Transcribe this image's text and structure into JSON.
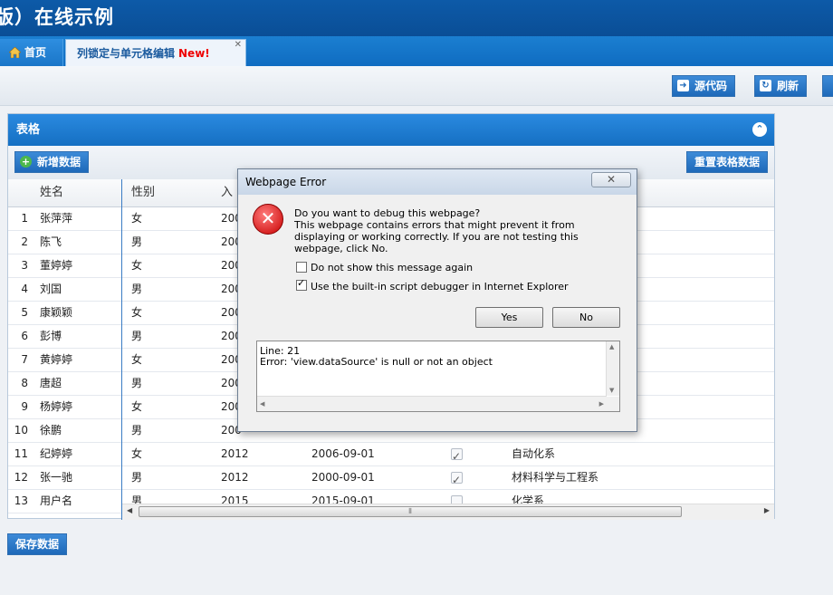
{
  "header": {
    "title": "版）在线示例"
  },
  "tabs": [
    {
      "label": "首页"
    },
    {
      "label": "列锁定与单元格编辑",
      "badge": "New!"
    }
  ],
  "toolbar": {
    "source_label": "源代码",
    "refresh_label": "刷新"
  },
  "panel": {
    "title": "表格",
    "add_label": "新增数据",
    "reset_label": "重置表格数据"
  },
  "grid": {
    "columns": [
      "姓名",
      "性别",
      "入"
    ],
    "rows": [
      {
        "n": "1",
        "name": "张萍萍",
        "sex": "女",
        "year": "200",
        "date": "",
        "checked": null,
        "dept": ""
      },
      {
        "n": "2",
        "name": "陈飞",
        "sex": "男",
        "year": "200",
        "date": "",
        "checked": null,
        "dept": ""
      },
      {
        "n": "3",
        "name": "董婷婷",
        "sex": "女",
        "year": "200",
        "date": "",
        "checked": null,
        "dept": ""
      },
      {
        "n": "4",
        "name": "刘国",
        "sex": "男",
        "year": "200",
        "date": "",
        "checked": null,
        "dept": ""
      },
      {
        "n": "5",
        "name": "康颖颖",
        "sex": "女",
        "year": "200",
        "date": "",
        "checked": null,
        "dept": ""
      },
      {
        "n": "6",
        "name": "彭博",
        "sex": "男",
        "year": "200",
        "date": "",
        "checked": null,
        "dept": ""
      },
      {
        "n": "7",
        "name": "黄婷婷",
        "sex": "女",
        "year": "200",
        "date": "",
        "checked": null,
        "dept": ""
      },
      {
        "n": "8",
        "name": "唐超",
        "sex": "男",
        "year": "200",
        "date": "",
        "checked": null,
        "dept": ""
      },
      {
        "n": "9",
        "name": "杨婷婷",
        "sex": "女",
        "year": "200",
        "date": "",
        "checked": null,
        "dept": ""
      },
      {
        "n": "10",
        "name": "徐鹏",
        "sex": "男",
        "year": "200",
        "date": "",
        "checked": null,
        "dept": ""
      },
      {
        "n": "11",
        "name": "纪婷婷",
        "sex": "女",
        "year": "2012",
        "date": "2006-09-01",
        "checked": true,
        "dept": "自动化系"
      },
      {
        "n": "12",
        "name": "张一驰",
        "sex": "男",
        "year": "2012",
        "date": "2000-09-01",
        "checked": true,
        "dept": "材料科学与工程系"
      },
      {
        "n": "13",
        "name": "用户名",
        "sex": "男",
        "year": "2015",
        "date": "2015-09-01",
        "checked": false,
        "dept": "化学系"
      }
    ]
  },
  "save_label": "保存数据",
  "dialog": {
    "title": "Webpage Error",
    "close_glyph": "✕",
    "question": "Do you want to debug this webpage?",
    "message": "This webpage contains errors that might prevent it from displaying or working correctly. If you are not testing this webpage, click No.",
    "option_dont_show": "Do not show this message again",
    "option_use_debugger": "Use the built-in script debugger in Internet Explorer",
    "option_dont_show_checked": false,
    "option_use_debugger_checked": true,
    "yes_label": "Yes",
    "no_label": "No",
    "detail_line": "Line: 21",
    "detail_error": "Error: 'view.dataSource' is null or not an object"
  },
  "colors": {
    "header": "#0d5aa8",
    "accent": "#1e69b9",
    "error": "#c80000"
  }
}
